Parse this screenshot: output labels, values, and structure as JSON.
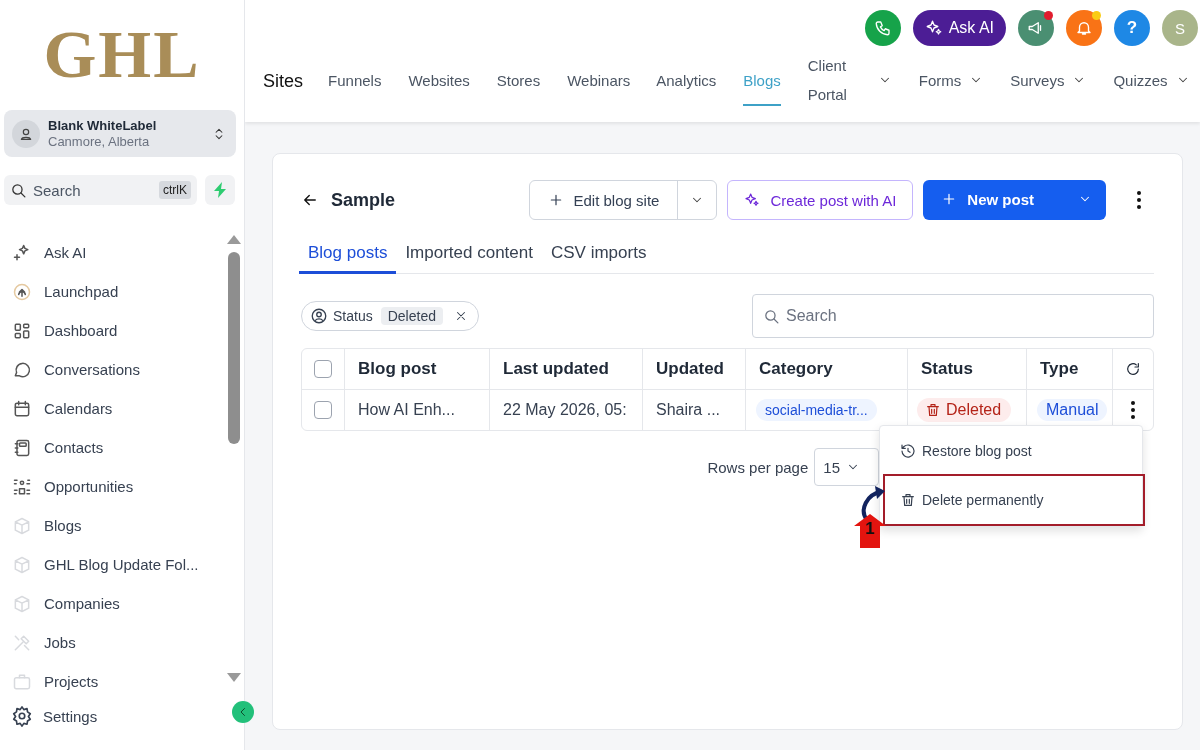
{
  "logo": {
    "text": "GHL"
  },
  "account": {
    "name": "Blank WhiteLabel",
    "location": "Canmore, Alberta"
  },
  "sidebar_search": {
    "placeholder": "Search",
    "shortcut": "ctrlK"
  },
  "sidebar": {
    "items": [
      {
        "label": "Ask AI",
        "faded": false
      },
      {
        "label": "Launchpad",
        "faded": false
      },
      {
        "label": "Dashboard",
        "faded": false
      },
      {
        "label": "Conversations",
        "faded": false
      },
      {
        "label": "Calendars",
        "faded": false
      },
      {
        "label": "Contacts",
        "faded": false
      },
      {
        "label": "Opportunities",
        "faded": false
      },
      {
        "label": "Blogs",
        "faded": true
      },
      {
        "label": "GHL Blog Update Fol...",
        "faded": true
      },
      {
        "label": "Companies",
        "faded": true
      },
      {
        "label": "Jobs",
        "faded": true
      },
      {
        "label": "Projects",
        "faded": true
      }
    ],
    "settings": "Settings"
  },
  "top_actions": {
    "ask_ai": "Ask AI",
    "help": "?",
    "avatar": "S"
  },
  "site_nav": {
    "title": "Sites",
    "tabs": [
      {
        "label": "Funnels",
        "selected": false,
        "dropdown": false
      },
      {
        "label": "Websites",
        "selected": false,
        "dropdown": false
      },
      {
        "label": "Stores",
        "selected": false,
        "dropdown": false
      },
      {
        "label": "Webinars",
        "selected": false,
        "dropdown": false
      },
      {
        "label": "Analytics",
        "selected": false,
        "dropdown": false
      },
      {
        "label": "Blogs",
        "selected": true,
        "dropdown": false
      },
      {
        "label": "Client Portal",
        "selected": false,
        "dropdown": true
      },
      {
        "label": "Forms",
        "selected": false,
        "dropdown": true
      },
      {
        "label": "Surveys",
        "selected": false,
        "dropdown": true
      },
      {
        "label": "Quizzes",
        "selected": false,
        "dropdown": true
      }
    ]
  },
  "blog": {
    "title": "Sample",
    "edit_button": "Edit blog site",
    "ai_button": "Create post with AI",
    "new_button": "New post"
  },
  "tabs": [
    {
      "label": "Blog posts",
      "selected": true
    },
    {
      "label": "Imported content",
      "selected": false
    },
    {
      "label": "CSV imports",
      "selected": false
    }
  ],
  "filter": {
    "label": "Status",
    "value": "Deleted"
  },
  "search": {
    "placeholder": "Search"
  },
  "table": {
    "header_checked": false,
    "columns": [
      "Blog post",
      "Last updated",
      "Updated",
      "Category",
      "Status",
      "Type"
    ],
    "rows": [
      {
        "checked": false,
        "title": "How AI Enh...",
        "updated": "22 May 2026, 05:",
        "author": "Shaira ...",
        "category": "social-media-tr...",
        "status": "Deleted",
        "type": "Manual"
      }
    ]
  },
  "pagination": {
    "label": "Rows per page",
    "value": "15"
  },
  "context_menu": {
    "items": [
      {
        "label": "Restore blog post",
        "kind": "restore",
        "highlighted": false
      },
      {
        "label": "Delete permanently",
        "kind": "delete",
        "highlighted": true
      }
    ]
  },
  "annotation": {
    "number": "1"
  }
}
